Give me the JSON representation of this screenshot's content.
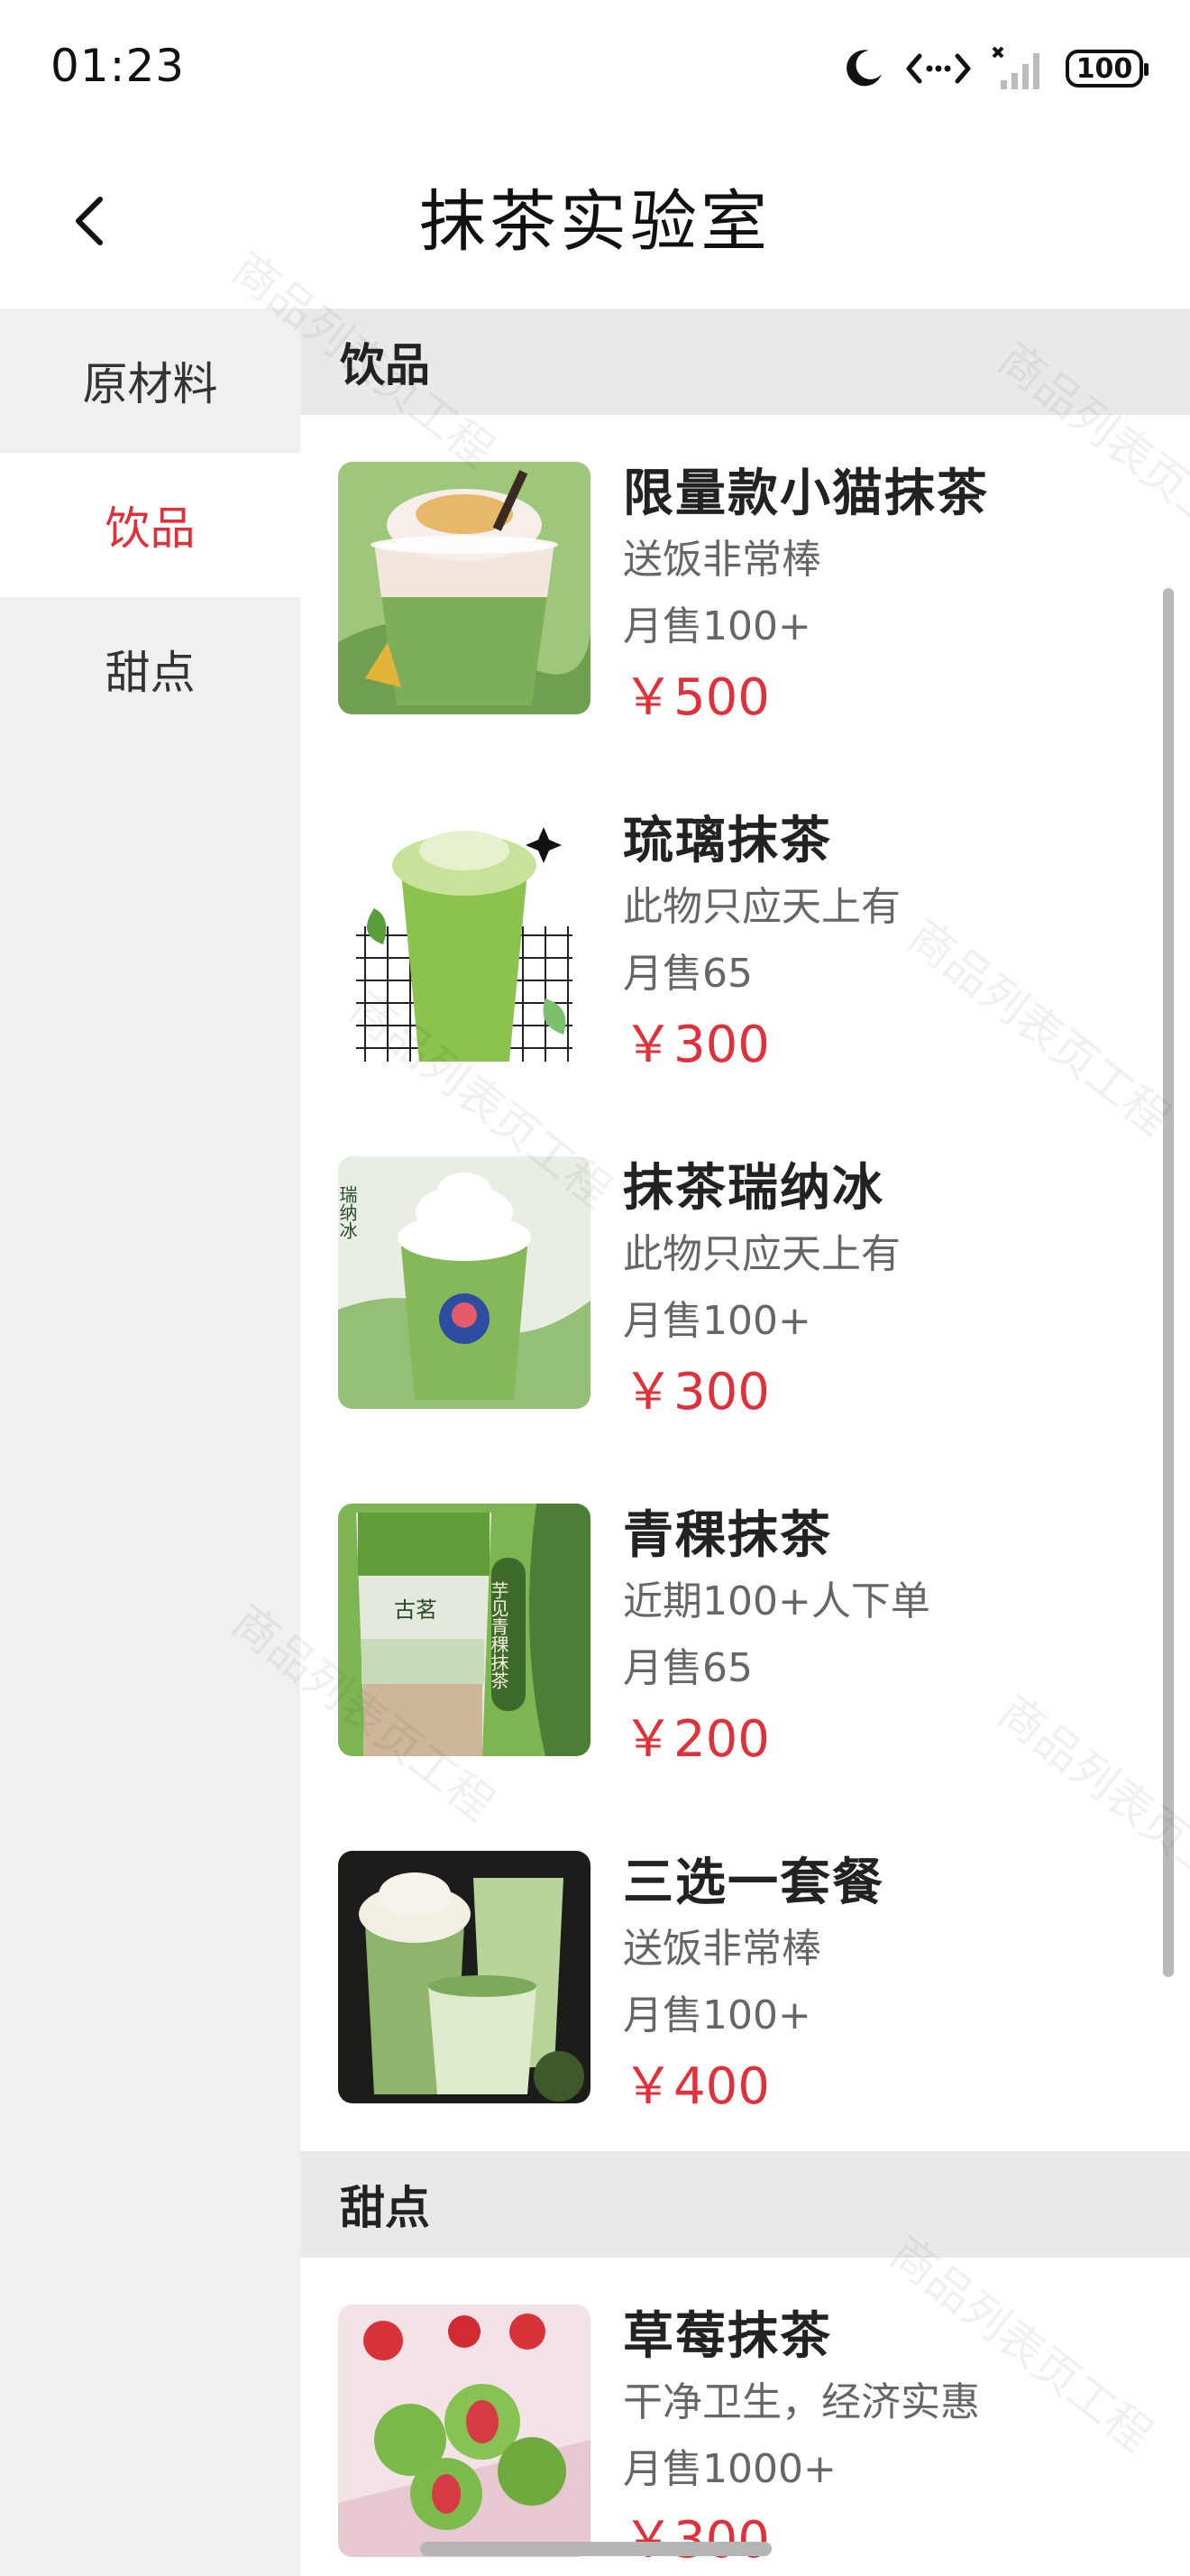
{
  "status_bar": {
    "time": "01:23",
    "battery": "100"
  },
  "nav": {
    "title": "抹茶实验室"
  },
  "sidebar": {
    "items": [
      {
        "label": "原材料"
      },
      {
        "label": "饮品"
      },
      {
        "label": "甜点"
      }
    ]
  },
  "sections": [
    {
      "title": "饮品",
      "products": [
        {
          "name": "限量款小猫抹茶",
          "desc": "送饭非常棒",
          "sales": "月售100+",
          "price": "￥500"
        },
        {
          "name": "琉璃抹茶",
          "desc": "此物只应天上有",
          "sales": "月售65",
          "price": "￥300"
        },
        {
          "name": "抹茶瑞纳冰",
          "desc": "此物只应天上有",
          "sales": "月售100+",
          "price": "￥300",
          "img_text": "瑞纳冰"
        },
        {
          "name": "青稞抹茶",
          "desc": "近期100+人下单",
          "sales": "月售65",
          "price": "￥200",
          "img_text": "芋见青稞抹茶",
          "img_logo": "古茗"
        },
        {
          "name": "三选一套餐",
          "desc": "送饭非常棒",
          "sales": "月售100+",
          "price": "￥400"
        }
      ]
    },
    {
      "title": "甜点",
      "products": [
        {
          "name": "草莓抹茶",
          "desc": "干净卫生，经济实惠",
          "sales": "月售1000+",
          "price": "￥300"
        }
      ]
    }
  ],
  "watermark": "商品列表页工程",
  "colors": {
    "accent": "#e0313b",
    "sidebar_bg": "#f0f0f0",
    "section_bg": "#e9e9e9"
  }
}
